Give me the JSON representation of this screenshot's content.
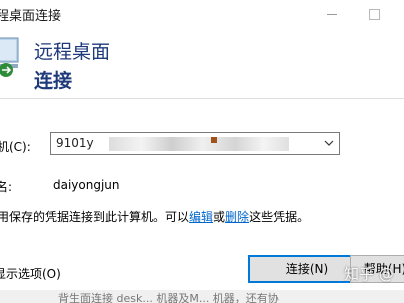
{
  "window": {
    "title": "程桌面连接"
  },
  "header": {
    "line1": "远程桌面",
    "line2": "连接"
  },
  "form": {
    "computer_label": "机(C):",
    "computer_value": "9101y",
    "user_label": "名:",
    "user_value": "daiyongjun",
    "cred_text_prefix": "用保存的凭据连接到此计算机。可以",
    "cred_edit_link": "编辑",
    "cred_or": "或",
    "cred_delete_link": "删除",
    "cred_text_suffix": "这些凭据。"
  },
  "footer": {
    "show_options": "显示选项(O)",
    "connect_button": "连接(N)",
    "help_button": "帮助(H)",
    "strip_text": "背生面连接 desk... 机器及M... 机器，还有协",
    "watermark": "知乎 @"
  },
  "icons": {
    "app": "remote-desktop-icon",
    "dropdown": "chevron-down-icon"
  },
  "colors": {
    "header_text": "#1e3a7b",
    "link": "#0066cc",
    "button_accent": "#0078d7"
  }
}
